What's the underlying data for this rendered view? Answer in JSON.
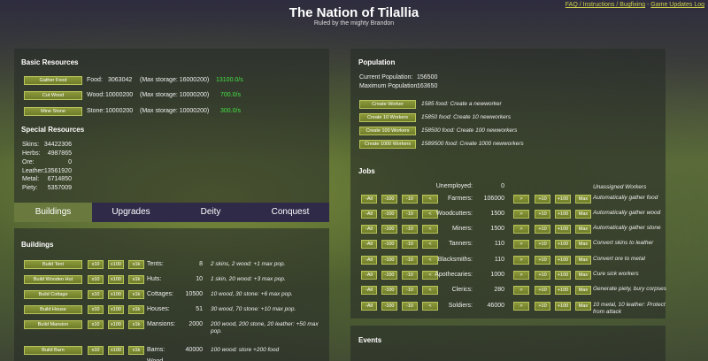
{
  "header": {
    "title": "The Nation of Tilallia",
    "subtitle": "Ruled by the mighty Brandon",
    "links": [
      "FAQ / Instructions / Bugfixing",
      "Game Updates Log"
    ],
    "link_sep": " - "
  },
  "basic": {
    "title": "Basic Resources",
    "rows": [
      {
        "button": "Gather Food",
        "label": "Food:",
        "amount": "3063042",
        "max": "(Max storage: 16000200)",
        "rate": "13100.0/s"
      },
      {
        "button": "Cut Wood",
        "label": "Wood:",
        "amount": "10000200",
        "max": "(Max storage: 10000200)",
        "rate": "700.0/s"
      },
      {
        "button": "Mine Stone",
        "label": "Stone:",
        "amount": "10000200",
        "max": "(Max storage: 10000200)",
        "rate": "300.0/s"
      }
    ]
  },
  "special": {
    "title": "Special Resources",
    "rows": [
      {
        "label": "Skins:",
        "value": "34422306"
      },
      {
        "label": "Herbs:",
        "value": "4987865"
      },
      {
        "label": "Ore:",
        "value": "0"
      },
      {
        "label": "Leather:",
        "value": "13561920"
      },
      {
        "label": "Metal:",
        "value": "6714850"
      },
      {
        "label": "Piety:",
        "value": "5357009"
      }
    ]
  },
  "tabs": [
    "Buildings",
    "Upgrades",
    "Deity",
    "Conquest"
  ],
  "buildings": {
    "title": "Buildings",
    "multipliers": [
      "x10",
      "x100",
      "x1k"
    ],
    "rows": [
      {
        "button": "Build Tent",
        "label": "Tents:",
        "count": "8",
        "desc": "2 skins, 2 wood: +1 max pop."
      },
      {
        "button": "Build Wooden Hut",
        "label": "Huts:",
        "count": "10",
        "desc": "1 skin, 20 wood: +3 max pop."
      },
      {
        "button": "Build Cottage",
        "label": "Cottages:",
        "count": "10500",
        "desc": "10 wood, 30 stone: +6 max pop."
      },
      {
        "button": "Build House",
        "label": "Houses:",
        "count": "51",
        "desc": "30 wood, 70 stone: +10 max pop."
      },
      {
        "button": "Build Mansion",
        "label": "Mansions:",
        "count": "2000",
        "desc": "200 wood, 200 stone, 20 leather: +50 max pop."
      },
      {
        "button": "Build Barn",
        "label": "Barns:",
        "count": "40000",
        "desc": "100 wood: store +200 food"
      },
      {
        "button": "",
        "label": "Wood",
        "count": "",
        "desc": ""
      }
    ]
  },
  "population": {
    "title": "Population",
    "current_label": "Current Population:",
    "current": "156500",
    "max_label": "Maximum Population:",
    "max": "163650",
    "create": [
      {
        "button": "Create Worker",
        "desc": "1585 food: Create a newworker"
      },
      {
        "button": "Create 10 Workers",
        "desc": "15850 food: Create 10 newworkers"
      },
      {
        "button": "Create 100 Workers",
        "desc": "158500 food: Create 100 newworkers"
      },
      {
        "button": "Create 1000 Workers",
        "desc": "1589500 food: Create 1000 newworkers"
      }
    ]
  },
  "jobs": {
    "title": "Jobs",
    "unemployed_label": "Unemployed:",
    "unemployed": "0",
    "unemployed_desc": "Unassigned Workers",
    "minus": [
      "-All",
      "-100",
      "-10",
      "<"
    ],
    "plus": [
      ">",
      "+10",
      "+100",
      "Max"
    ],
    "rows": [
      {
        "label": "Farmers:",
        "count": "106000",
        "desc": "Automatically gather food"
      },
      {
        "label": "Woodcutters:",
        "count": "1500",
        "desc": "Automatically gather wood"
      },
      {
        "label": "Miners:",
        "count": "1500",
        "desc": "Automatically gather stone"
      },
      {
        "label": "Tanners:",
        "count": "110",
        "desc": "Convert skins to leather"
      },
      {
        "label": "Blacksmiths:",
        "count": "110",
        "desc": "Convert ore to metal"
      },
      {
        "label": "Apothecaries:",
        "count": "1000",
        "desc": "Cure sick workers"
      },
      {
        "label": "Clerics:",
        "count": "280",
        "desc": "Generate piety, bury corpses"
      },
      {
        "label": "Soldiers:",
        "count": "46000",
        "desc": "10 metal, 10 leather: Protect from attack"
      }
    ]
  },
  "events": {
    "title": "Events"
  },
  "colors": {
    "button": "#7f8d33",
    "rate": "#44e044",
    "tab_active": "#6a7a3e",
    "tab_bar": "#2f2a48",
    "link": "#cfd14a"
  }
}
